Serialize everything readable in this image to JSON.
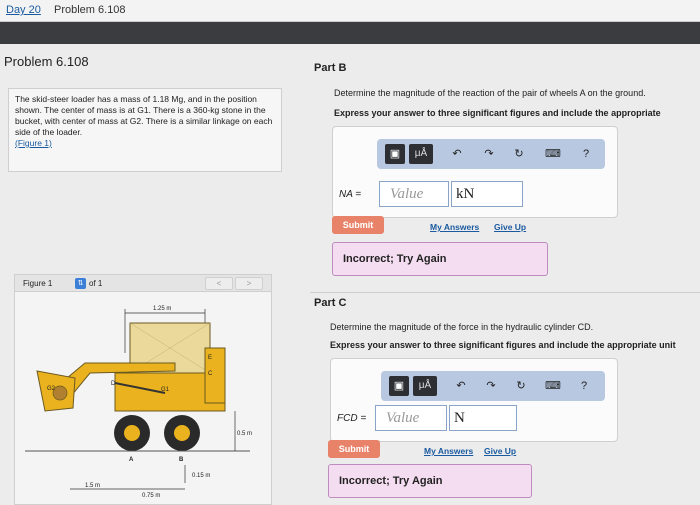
{
  "tab": {
    "day_link": "Day 20",
    "title": "Problem 6.108"
  },
  "problem": {
    "title": "Problem 6.108",
    "text": "The skid-steer loader has a mass of 1.18 Mg, and in the position shown. The center of mass is at G1. There is a 360-kg stone in the bucket, with center of mass at G2. There is a similar linkage on each side of the loader.",
    "figure_link": "(Figure 1)"
  },
  "figure": {
    "label": "Figure 1",
    "of": "of 1",
    "prev": "<",
    "next": ">",
    "dims": {
      "top": "1.25 m",
      "right": "0.5 m",
      "bottom_mid": "0.15 m",
      "left_a": "1.5 m",
      "left_b": "0.75 m"
    },
    "points": {
      "A": "A",
      "B": "B",
      "C": "C",
      "D": "D",
      "E": "E",
      "G1": "G1",
      "G2": "G2"
    }
  },
  "part_b": {
    "title": "Part B",
    "question": "Determine the magnitude of the reaction of the pair of wheels A on the ground.",
    "instruction": "Express your answer to three significant figures and include the appropriate",
    "eq_label": "NA =",
    "value_placeholder": "Value",
    "unit": "kN",
    "submit": "Submit",
    "my_answers": "My Answers",
    "give_up": "Give Up",
    "feedback": "Incorrect; Try Again"
  },
  "part_c": {
    "title": "Part C",
    "question": "Determine the magnitude of the force in the hydraulic cylinder CD.",
    "instruction": "Express your answer to three significant figures and include the appropriate unit",
    "eq_label": "FCD =",
    "value_placeholder": "Value",
    "unit": "N",
    "submit": "Submit",
    "my_answers": "My Answers",
    "give_up": "Give Up",
    "feedback": "Incorrect; Try Again"
  },
  "toolbar": {
    "mu": "μÅ",
    "help": "?"
  },
  "colors": {
    "accent": "#3b7fd6",
    "submit": "#e8836a",
    "feedback_bg": "#f4ddf0",
    "toolbar": "#b7c8e0"
  }
}
